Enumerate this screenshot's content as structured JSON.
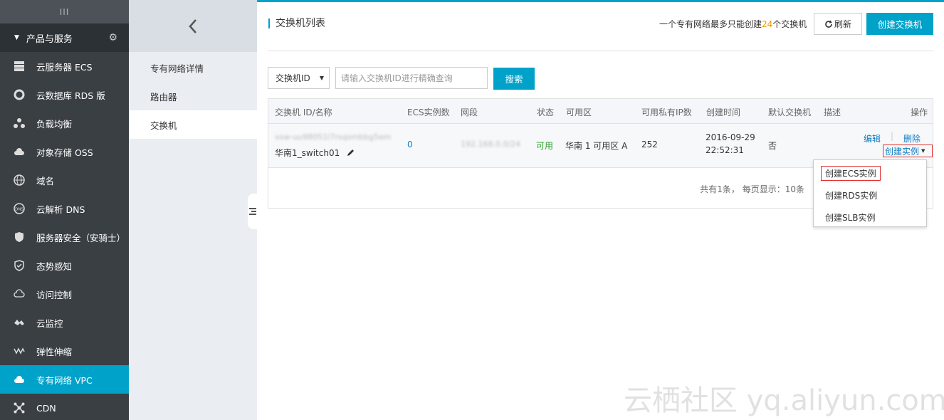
{
  "sidebar": {
    "collapse_glyph": "III",
    "header": "产品与服务",
    "items": [
      {
        "label": "云服务器 ECS",
        "icon": "server-icon"
      },
      {
        "label": "云数据库 RDS 版",
        "icon": "database-icon"
      },
      {
        "label": "负载均衡",
        "icon": "load-balancer-icon"
      },
      {
        "label": "对象存储 OSS",
        "icon": "cloud-storage-icon"
      },
      {
        "label": "域名",
        "icon": "globe-icon"
      },
      {
        "label": "云解析 DNS",
        "icon": "dns-icon"
      },
      {
        "label": "服务器安全（安骑士）",
        "icon": "shield-icon"
      },
      {
        "label": "态势感知",
        "icon": "shield-check-icon"
      },
      {
        "label": "访问控制",
        "icon": "cloud-outline-icon"
      },
      {
        "label": "云监控",
        "icon": "monitor-icon"
      },
      {
        "label": "弹性伸缩",
        "icon": "scaling-icon"
      },
      {
        "label": "专有网络 VPC",
        "icon": "vpc-cloud-icon",
        "active": true
      },
      {
        "label": "CDN",
        "icon": "cdn-icon"
      }
    ]
  },
  "subnav": {
    "items": [
      {
        "label": "专有网络详情"
      },
      {
        "label": "路由器"
      },
      {
        "label": "交换机",
        "active": true
      }
    ]
  },
  "header": {
    "title": "交换机列表",
    "quota_prefix": "一个专有网络最多只能创建",
    "quota_num": "24",
    "quota_suffix": "个交换机",
    "refresh_label": "刷新",
    "create_label": "创建交换机"
  },
  "filter": {
    "select_value": "交换机ID",
    "placeholder": "请输入交换机ID进行精确查询",
    "search_label": "搜索"
  },
  "table": {
    "columns": [
      "交换机 ID/名称",
      "ECS实例数",
      "网段",
      "状态",
      "可用区",
      "可用私有IP数",
      "创建时间",
      "默认交换机",
      "描述",
      "操作"
    ],
    "rows": [
      {
        "id": "vsw-uu98051l7rsqsmbbg5em",
        "name": "华南1_switch01",
        "ecs_count": "0",
        "cidr": "192.168.0.0/24",
        "status": "可用",
        "zone": "华南 1 可用区 A",
        "ip_count": "252",
        "created_date": "2016-09-29",
        "created_time": "22:52:31",
        "default": "否",
        "desc": "",
        "op_edit": "编辑",
        "op_delete": "删除",
        "op_create": "创建实例"
      }
    ],
    "footer": "共有1条， 每页显示：10条"
  },
  "dropdown_menu": {
    "items": [
      "创建ECS实例",
      "创建RDS实例",
      "创建SLB实例"
    ]
  },
  "watermark": "云栖社区 yq.aliyun.com",
  "colors": {
    "accent": "#00A2CA",
    "sidebar": "#3a3f44",
    "link": "#0f7dc2",
    "ok": "#2f9e2f",
    "warn": "#f39800"
  }
}
